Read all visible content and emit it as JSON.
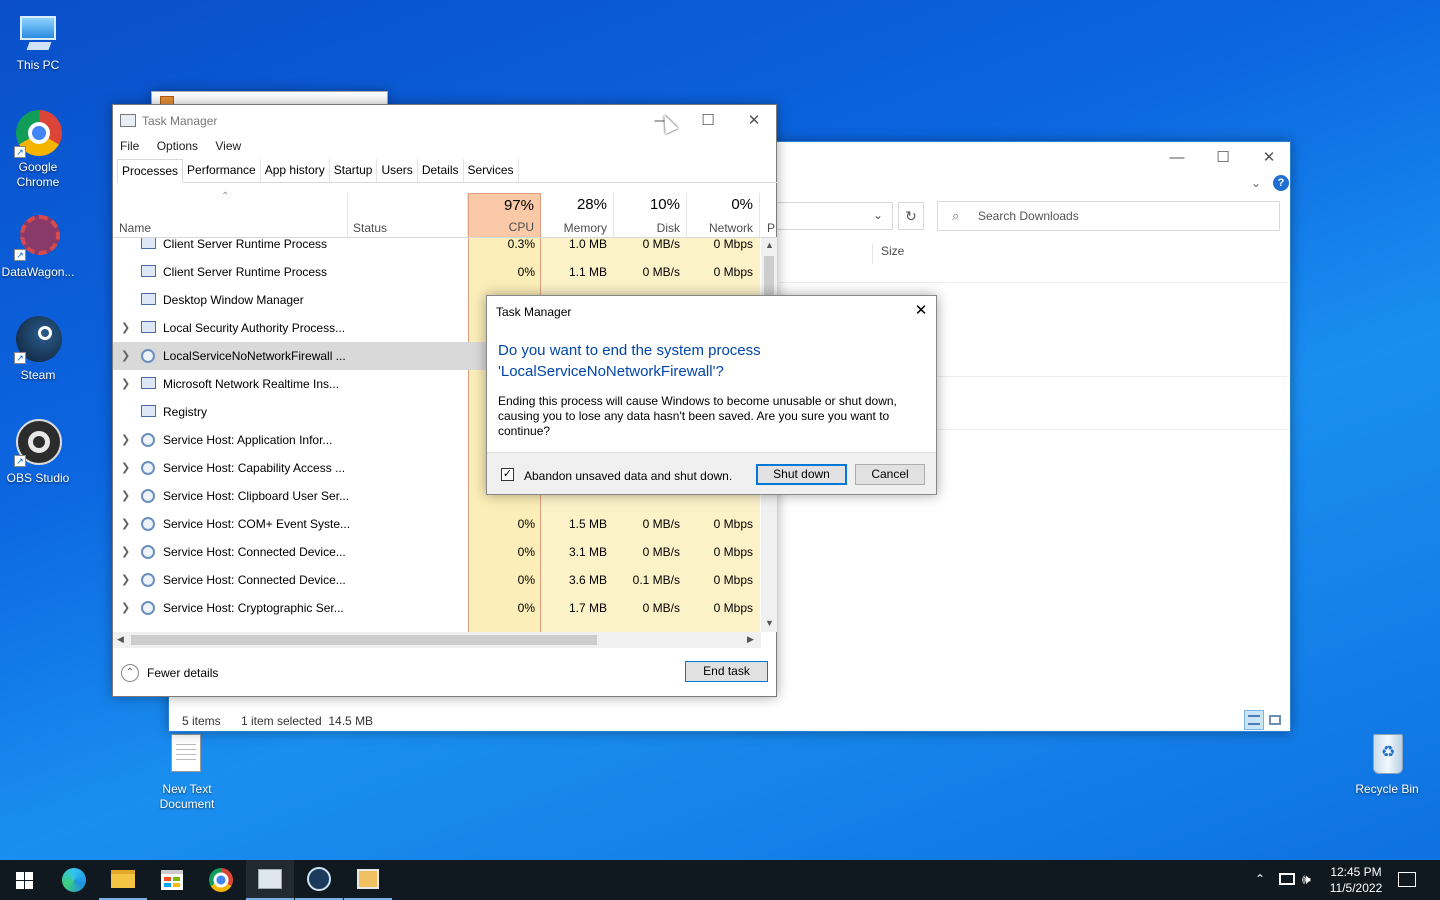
{
  "desktop": {
    "icons": [
      {
        "label": "This PC"
      },
      {
        "label": "Google\nChrome"
      },
      {
        "label": "DataWagon..."
      },
      {
        "label": "Steam"
      },
      {
        "label": "OBS Studio"
      },
      {
        "label": "New Text\nDocument"
      },
      {
        "label": "Recycle Bin"
      }
    ]
  },
  "explorer": {
    "search_placeholder": "Search Downloads",
    "column_size": "Size",
    "status_items": "5 items",
    "status_selected": "1 item selected  14.5 MB",
    "help": "?"
  },
  "taskmanager": {
    "title": "Task Manager",
    "menu": [
      "File",
      "Options",
      "View"
    ],
    "tabs": [
      "Processes",
      "Performance",
      "App history",
      "Startup",
      "Users",
      "Details",
      "Services"
    ],
    "columns": {
      "name": "Name",
      "status": "Status",
      "cpu_pct": "97%",
      "cpu": "CPU",
      "mem_pct": "28%",
      "mem": "Memory",
      "disk_pct": "10%",
      "disk": "Disk",
      "net_pct": "0%",
      "net": "Network",
      "power": "P"
    },
    "rows": [
      {
        "name": "Client Server Runtime Process",
        "cpu": "0.3%",
        "mem": "1.0 MB",
        "disk": "0 MB/s",
        "net": "0 Mbps"
      },
      {
        "name": "Client Server Runtime Process",
        "cpu": "0%",
        "mem": "1.1 MB",
        "disk": "0 MB/s",
        "net": "0 Mbps"
      },
      {
        "name": "Desktop Window Manager",
        "cpu": "",
        "mem": "",
        "disk": "",
        "net": ""
      },
      {
        "name": "Local Security Authority Process...",
        "cpu": "",
        "mem": "",
        "disk": "",
        "net": ""
      },
      {
        "name": "LocalServiceNoNetworkFirewall ...",
        "cpu": "",
        "mem": "",
        "disk": "",
        "net": ""
      },
      {
        "name": "Microsoft Network Realtime Ins...",
        "cpu": "",
        "mem": "",
        "disk": "",
        "net": ""
      },
      {
        "name": "Registry",
        "cpu": "",
        "mem": "",
        "disk": "",
        "net": ""
      },
      {
        "name": "Service Host: Application Infor...",
        "cpu": "",
        "mem": "",
        "disk": "",
        "net": ""
      },
      {
        "name": "Service Host: Capability Access ...",
        "cpu": "",
        "mem": "",
        "disk": "",
        "net": ""
      },
      {
        "name": "Service Host: Clipboard User Ser...",
        "cpu": "",
        "mem": "",
        "disk": "",
        "net": ""
      },
      {
        "name": "Service Host: COM+ Event Syste...",
        "cpu": "0%",
        "mem": "1.5 MB",
        "disk": "0 MB/s",
        "net": "0 Mbps"
      },
      {
        "name": "Service Host: Connected Device...",
        "cpu": "0%",
        "mem": "3.1 MB",
        "disk": "0 MB/s",
        "net": "0 Mbps"
      },
      {
        "name": "Service Host: Connected Device...",
        "cpu": "0%",
        "mem": "3.6 MB",
        "disk": "0.1 MB/s",
        "net": "0 Mbps"
      },
      {
        "name": "Service Host: Cryptographic Ser...",
        "cpu": "0%",
        "mem": "1.7 MB",
        "disk": "0 MB/s",
        "net": "0 Mbps"
      }
    ],
    "fewer_details": "Fewer details",
    "end_task": "End task"
  },
  "dialog": {
    "title": "Task Manager",
    "question": "Do you want to end the system process 'LocalServiceNoNetworkFirewall'?",
    "body": "Ending this process will cause Windows to become unusable or shut down, causing you to lose any data hasn't been saved. Are you sure you want to continue?",
    "checkbox_label": "Abandon unsaved data and shut down.",
    "checkbox_checked": true,
    "shutdown": "Shut down",
    "cancel": "Cancel"
  },
  "taskbar": {
    "time": "12:45 PM",
    "date": "11/5/2022"
  },
  "colors": {
    "accent": "#0078d7",
    "cpu_header": "#f9c9a8",
    "cpu_column": "#fbeeb8",
    "dialog_heading": "#0046ad"
  }
}
